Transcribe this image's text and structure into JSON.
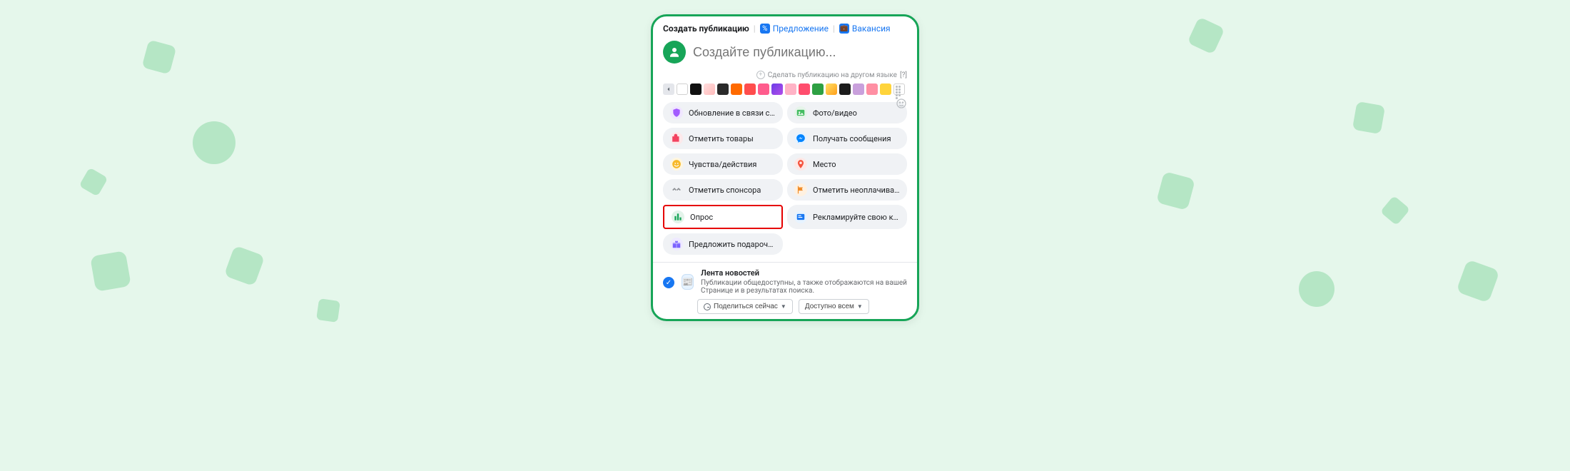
{
  "tabs": {
    "create": "Создать публикацию",
    "offer": "Предложение",
    "vacancy": "Вакансия"
  },
  "composer": {
    "placeholder": "Создайте публикацию...",
    "other_lang": "Сделать публикацию на другом языке",
    "other_lang_hint": "[?]"
  },
  "swatches": [
    {
      "bg": "#ffffff",
      "border": "#d0d0d0"
    },
    {
      "bg": "#111111"
    },
    {
      "bg": "linear-gradient(135deg,#fdd,#fbb)"
    },
    {
      "bg": "#2a2a2a"
    },
    {
      "bg": "#ff6a00"
    },
    {
      "bg": "#ff4d4d"
    },
    {
      "bg": "#ff5c8d"
    },
    {
      "bg": "linear-gradient(135deg,#6a3de8,#b34de8)"
    },
    {
      "bg": "#ffb3c6"
    },
    {
      "bg": "#ff4d6d"
    },
    {
      "bg": "#2ea043"
    },
    {
      "bg": "linear-gradient(135deg,#ffe066,#ff9f1a)"
    },
    {
      "bg": "#1c1c1c"
    },
    {
      "bg": "#c9a0dc"
    },
    {
      "bg": "#ff8fa3"
    },
    {
      "bg": "#ffd43b"
    }
  ],
  "options": [
    {
      "label": "Обновление в связи с COVI…",
      "icon": "shield-icon",
      "color": "#a259ff",
      "bg": "#f0e6ff"
    },
    {
      "label": "Фото/видео",
      "icon": "photo-icon",
      "color": "#45bd62",
      "bg": "#e6f4ea"
    },
    {
      "label": "Отметить товары",
      "icon": "bag-icon",
      "color": "#f3425f",
      "bg": "#fde8ea"
    },
    {
      "label": "Получать сообщения",
      "icon": "messenger-icon",
      "color": "#0084ff",
      "bg": "#e7f3ff"
    },
    {
      "label": "Чувства/действия",
      "icon": "smile-icon",
      "color": "#f7b928",
      "bg": "#fff6df"
    },
    {
      "label": "Место",
      "icon": "pin-icon",
      "color": "#f5533d",
      "bg": "#fde8e6"
    },
    {
      "label": "Отметить спонсора",
      "icon": "handshake-icon",
      "color": "#8a8d91",
      "bg": "#f0f2f5"
    },
    {
      "label": "Отметить неоплачиваемую …",
      "icon": "flag-icon",
      "color": "#f08c29",
      "bg": "#fff1e0"
    },
    {
      "label": "Опрос",
      "icon": "poll-icon",
      "color": "#17a558",
      "bg": "#e3f3ea",
      "highlight": true
    },
    {
      "label": "Рекламируйте свою компан…",
      "icon": "ad-icon",
      "color": "#1877f2",
      "bg": "#e7f3ff"
    },
    {
      "label": "Предложить подарочные к…",
      "icon": "gift-icon",
      "color": "#7b61ff",
      "bg": "#eee9ff"
    }
  ],
  "footer": {
    "feed_title": "Лента новостей",
    "feed_desc": "Публикации общедоступны, а также отображаются на вашей Странице и в результатах поиска.",
    "share_now": "Поделиться сейчас",
    "visible_to": "Доступно всем"
  }
}
